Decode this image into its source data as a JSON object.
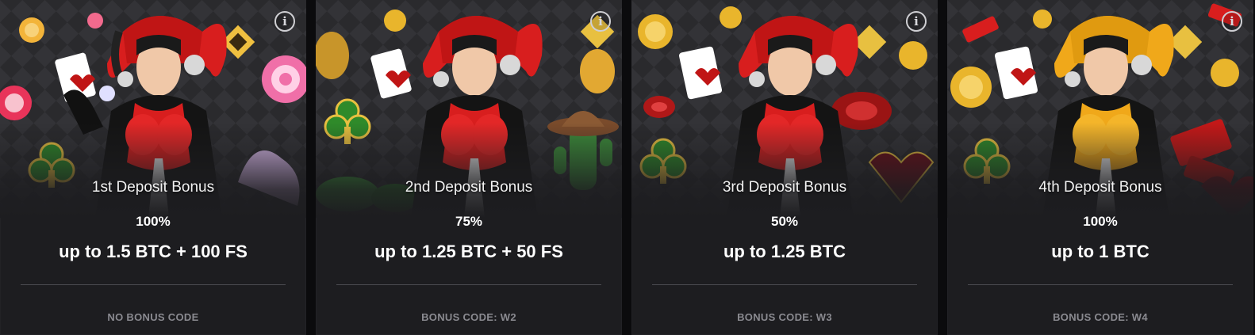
{
  "info_glyph": "i",
  "cards": [
    {
      "title": "1st Deposit Bonus",
      "percent": "100%",
      "amount": "up to 1.5 BTC + 100 FS",
      "code": "NO BONUS CODE",
      "suit_color": "#d81e1e",
      "theme": "candy"
    },
    {
      "title": "2nd Deposit Bonus",
      "percent": "75%",
      "amount": "up to 1.25 BTC + 50 FS",
      "code": "BONUS CODE: W2",
      "suit_color": "#d81e1e",
      "theme": "western"
    },
    {
      "title": "3rd Deposit Bonus",
      "percent": "50%",
      "amount": "up to 1.25 BTC",
      "code": "BONUS CODE: W3",
      "suit_color": "#d81e1e",
      "theme": "chips"
    },
    {
      "title": "4th Deposit Bonus",
      "percent": "100%",
      "amount": "up to 1 BTC",
      "code": "BONUS CODE: W4",
      "suit_color": "#f0a81a",
      "theme": "tickets"
    }
  ]
}
